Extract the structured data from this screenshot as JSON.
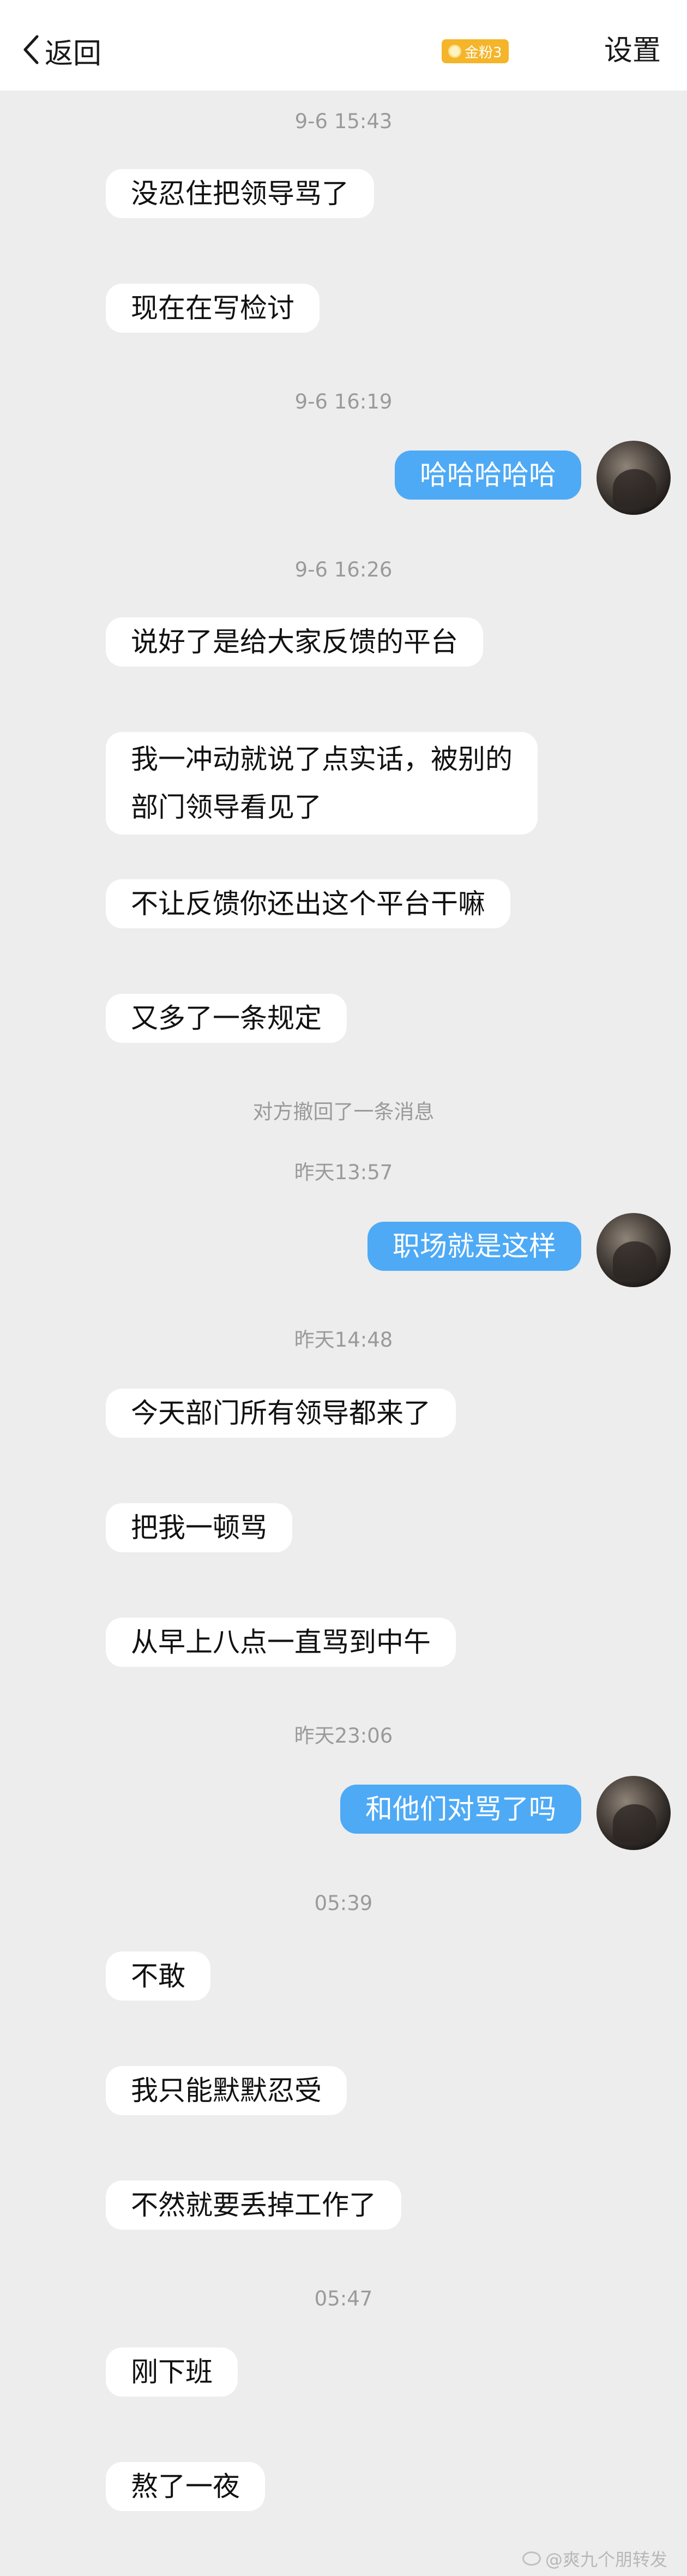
{
  "header": {
    "back_label": "返回",
    "badge_label": "金粉3",
    "settings_label": "设置"
  },
  "colors": {
    "background": "#ededed",
    "self_bubble": "#4eaaf5",
    "other_bubble": "#ffffff",
    "badge": "#f4b52a"
  },
  "messages": {
    "t1": "9-6 15:43",
    "m1": "没忍住把领导骂了",
    "m2": "现在在写检讨",
    "t2": "9-6 16:19",
    "m3": "哈哈哈哈哈",
    "t3": "9-6 16:26",
    "m4": "说好了是给大家反馈的平台",
    "m5_line1": "我一冲动就说了点实话，被别的",
    "m5_line2": "部门领导看见了",
    "m6": "不让反馈你还出这个平台干嘛",
    "m7": "又多了一条规定",
    "recall": "对方撤回了一条消息",
    "t4": "昨天13:57",
    "m8": "职场就是这样",
    "t5": "昨天14:48",
    "m9": "今天部门所有领导都来了",
    "m10": "把我一顿骂",
    "m11": "从早上八点一直骂到中午",
    "t6": "昨天23:06",
    "m12": "和他们对骂了吗",
    "t7": "05:39",
    "m13": "不敢",
    "m14": "我只能默默忍受",
    "m15": "不然就要丢掉工作了",
    "t8": "05:47",
    "m16": "刚下班",
    "m17": "熬了一夜"
  },
  "watermark": "@爽九个朋转发"
}
